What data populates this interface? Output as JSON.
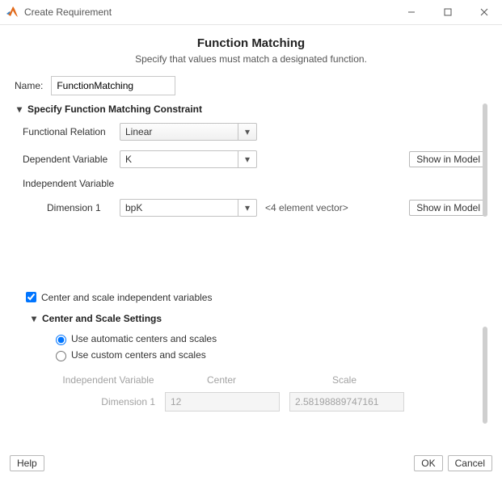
{
  "window": {
    "title": "Create Requirement"
  },
  "heading": "Function Matching",
  "subtitle": "Specify that values must match a designated function.",
  "name_label": "Name:",
  "name_value": "FunctionMatching",
  "section1": {
    "title": "Specify Function Matching Constraint",
    "functional_relation_label": "Functional Relation",
    "functional_relation_value": "Linear",
    "dependent_variable_label": "Dependent Variable",
    "dependent_variable_value": "K",
    "independent_variable_label": "Independent Variable",
    "dim1_label": "Dimension 1",
    "dim1_value": "bpK",
    "dim1_hint": "<4 element vector>",
    "show_in_model": "Show in Model"
  },
  "center_scale": {
    "checkbox_label": "Center and scale independent variables",
    "checkbox_checked": true,
    "section_title": "Center and Scale Settings",
    "radio_auto": "Use automatic centers and scales",
    "radio_custom": "Use custom centers and scales",
    "radio_selected": "auto",
    "table": {
      "col_iv": "Independent Variable",
      "col_center": "Center",
      "col_scale": "Scale",
      "row_label": "Dimension 1",
      "center_value": "12",
      "scale_value": "2.58198889747161"
    }
  },
  "footer": {
    "help": "Help",
    "ok": "OK",
    "cancel": "Cancel"
  }
}
